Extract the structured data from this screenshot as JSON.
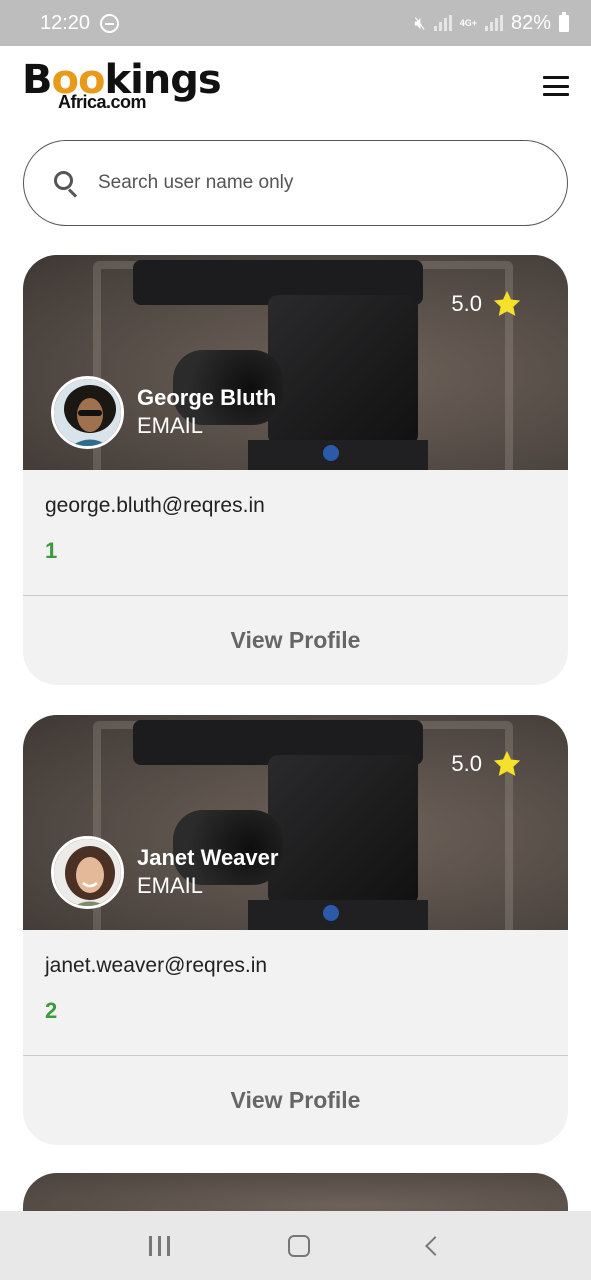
{
  "status_bar": {
    "time": "12:20",
    "battery": "82%",
    "network": "4G+"
  },
  "header": {
    "logo_main_pre": "B",
    "logo_main_oo": "oo",
    "logo_main_post": "kings",
    "logo_sub": "Africa.com",
    "menu_icon": "hamburger-menu-icon"
  },
  "search": {
    "placeholder": "Search user name only",
    "value": ""
  },
  "users": [
    {
      "name": "George Bluth",
      "email_label": "EMAIL",
      "email": "george.bluth@reqres.in",
      "id": "1",
      "rating": "5.0",
      "view_label": "View Profile"
    },
    {
      "name": "Janet Weaver",
      "email_label": "EMAIL",
      "email": "janet.weaver@reqres.in",
      "id": "2",
      "rating": "5.0",
      "view_label": "View Profile"
    }
  ],
  "colors": {
    "accent_green": "#3c9a3c",
    "star_yellow": "#f5e02a",
    "logo_orange": "#e89a1a"
  }
}
